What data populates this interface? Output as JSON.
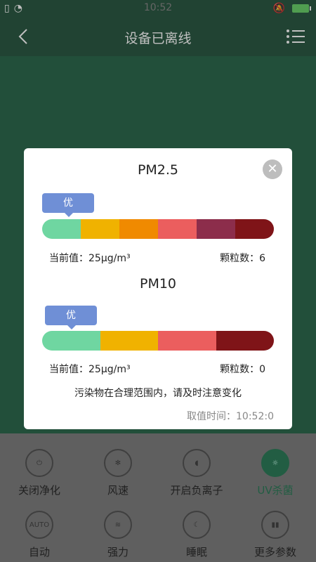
{
  "status": {
    "time": "10:52"
  },
  "header": {
    "title": "设备已离线"
  },
  "modal": {
    "pm25": {
      "title": "PM2.5",
      "level": "优",
      "current_label": "当前值：",
      "current_value": "25μg/m³",
      "count_label": "颗粒数：",
      "count_value": "6",
      "segments": [
        "#6fd6a1",
        "#f0b200",
        "#f08a00",
        "#eb5e5e",
        "#8c2d4b",
        "#7f1418"
      ]
    },
    "pm10": {
      "title": "PM10",
      "level": "优",
      "current_label": "当前值：",
      "current_value": "25μg/m³",
      "count_label": "颗粒数：",
      "count_value": "0",
      "segments": [
        "#6fd6a1",
        "#f0b200",
        "#eb5e5e",
        "#7f1418"
      ]
    },
    "tip": "污染物在合理范围内，请及时注意变化",
    "time_label": "取值时间：10:52:0"
  },
  "controls": [
    {
      "label": "关闭净化",
      "icon": "power-icon",
      "active": false
    },
    {
      "label": "风速",
      "icon": "fan-icon",
      "active": false
    },
    {
      "label": "开启负离子",
      "icon": "drop-icon",
      "active": false
    },
    {
      "label": "UV杀菌",
      "icon": "uv-icon",
      "active": true
    },
    {
      "label": "自动",
      "icon": "auto-icon",
      "active": false,
      "text": "AUTO"
    },
    {
      "label": "强力",
      "icon": "wind-icon",
      "active": false
    },
    {
      "label": "睡眠",
      "icon": "moon-icon",
      "active": false
    },
    {
      "label": "更多参数",
      "icon": "chart-icon",
      "active": false
    }
  ]
}
